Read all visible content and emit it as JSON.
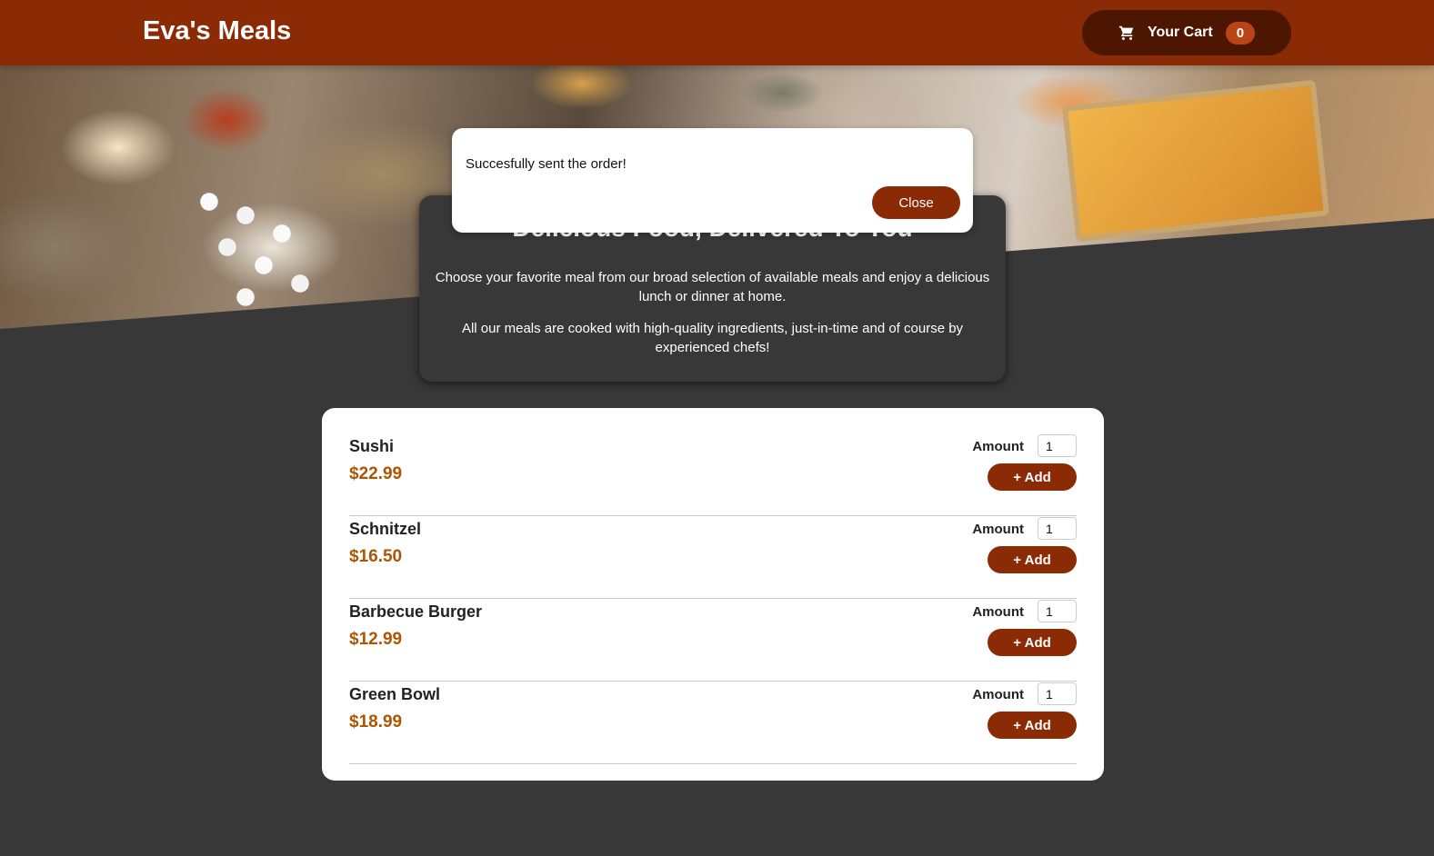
{
  "header": {
    "brand": "Eva's Meals",
    "cart": {
      "label": "Your Cart",
      "count": "0",
      "icon": "cart-icon"
    }
  },
  "summary": {
    "title": "Delicious Food, Delivered To You",
    "paragraph1": "Choose your favorite meal from our broad selection of available meals and enjoy a delicious lunch or dinner at home.",
    "paragraph2": "All our meals are cooked with high-quality ingredients, just-in-time and of course by experienced chefs!"
  },
  "meals": [
    {
      "name": "Sushi",
      "price": "$22.99",
      "amount_label": "Amount",
      "amount": "1",
      "add_label": "+ Add"
    },
    {
      "name": "Schnitzel",
      "price": "$16.50",
      "amount_label": "Amount",
      "amount": "1",
      "add_label": "+ Add"
    },
    {
      "name": "Barbecue Burger",
      "price": "$12.99",
      "amount_label": "Amount",
      "amount": "1",
      "add_label": "+ Add"
    },
    {
      "name": "Green Bowl",
      "price": "$18.99",
      "amount_label": "Amount",
      "amount": "1",
      "add_label": "+ Add"
    }
  ],
  "modal": {
    "message": "Succesfully sent the order!",
    "close_label": "Close"
  },
  "colors": {
    "primary": "#8a2b06",
    "background": "#383838",
    "price": "#ad5502"
  }
}
